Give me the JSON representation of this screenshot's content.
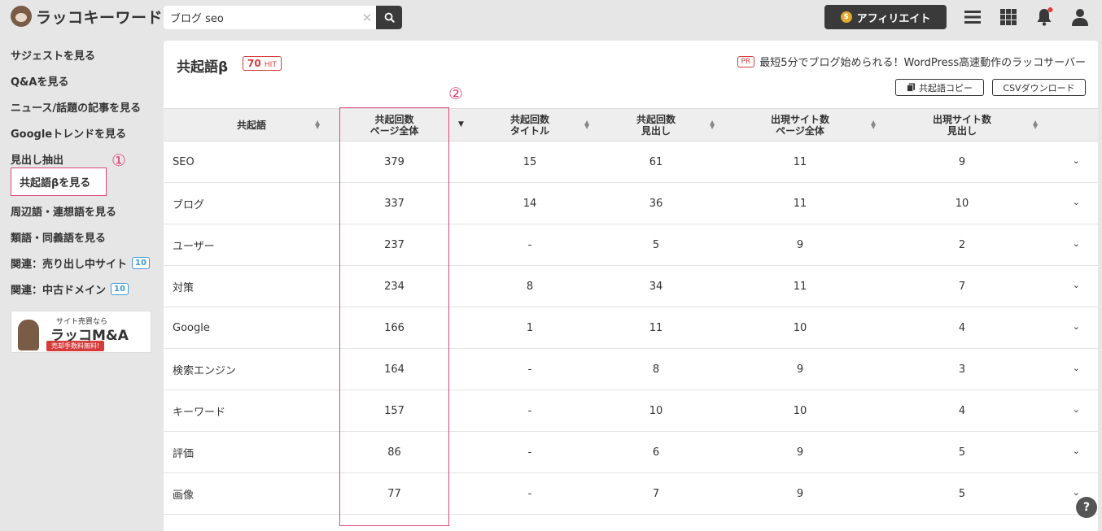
{
  "header": {
    "logo_text": "ラッコキーワード",
    "search_value": "ブログ seo",
    "affiliate_label": "アフィリエイト"
  },
  "sidebar": {
    "items": [
      {
        "label": "サジェストを見る"
      },
      {
        "label": "Q&Aを見る"
      },
      {
        "label": "ニュース/話題の記事を見る"
      },
      {
        "label": "Googleトレンドを見る"
      },
      {
        "label": "見出し抽出"
      },
      {
        "label": "共起語βを見る"
      },
      {
        "label": "周辺語・連想語を見る"
      },
      {
        "label": "類語・同義語を見る"
      },
      {
        "label": "関連：売り出し中サイト",
        "badge": "10"
      },
      {
        "label": "関連：中古ドメイン",
        "badge": "10"
      }
    ],
    "annotation_1": "①",
    "banner": {
      "small": "サイト売買なら",
      "big": "ラッコM&A",
      "red": "売却手数料無料!"
    }
  },
  "main": {
    "title": "共起語β",
    "hit_count": "70",
    "hit_label": "HIT",
    "pr_tag": "PR",
    "pr_text": "最短5分でブログ始められる！WordPress高速動作のラッコサーバー",
    "copy_button": "共起語コピー",
    "csv_button": "CSVダウンロード",
    "annotation_2": "②",
    "columns": [
      {
        "line1": "共起語",
        "line2": ""
      },
      {
        "line1": "共起回数",
        "line2": "ページ全体"
      },
      {
        "line1": "共起回数",
        "line2": "タイトル"
      },
      {
        "line1": "共起回数",
        "line2": "見出し"
      },
      {
        "line1": "出現サイト数",
        "line2": "ページ全体"
      },
      {
        "line1": "出現サイト数",
        "line2": "見出し"
      }
    ],
    "rows": [
      {
        "word": "SEO",
        "page": "379",
        "title": "15",
        "heading": "61",
        "sites_page": "11",
        "sites_heading": "9"
      },
      {
        "word": "ブログ",
        "page": "337",
        "title": "14",
        "heading": "36",
        "sites_page": "11",
        "sites_heading": "10"
      },
      {
        "word": "ユーザー",
        "page": "237",
        "title": "-",
        "heading": "5",
        "sites_page": "9",
        "sites_heading": "2"
      },
      {
        "word": "対策",
        "page": "234",
        "title": "8",
        "heading": "34",
        "sites_page": "11",
        "sites_heading": "7"
      },
      {
        "word": "Google",
        "page": "166",
        "title": "1",
        "heading": "11",
        "sites_page": "10",
        "sites_heading": "4"
      },
      {
        "word": "検索エンジン",
        "page": "164",
        "title": "-",
        "heading": "8",
        "sites_page": "9",
        "sites_heading": "3"
      },
      {
        "word": "キーワード",
        "page": "157",
        "title": "-",
        "heading": "10",
        "sites_page": "10",
        "sites_heading": "4"
      },
      {
        "word": "評価",
        "page": "86",
        "title": "-",
        "heading": "6",
        "sites_page": "9",
        "sites_heading": "5"
      },
      {
        "word": "画像",
        "page": "77",
        "title": "-",
        "heading": "7",
        "sites_page": "9",
        "sites_heading": "5"
      }
    ]
  },
  "help_label": "?"
}
